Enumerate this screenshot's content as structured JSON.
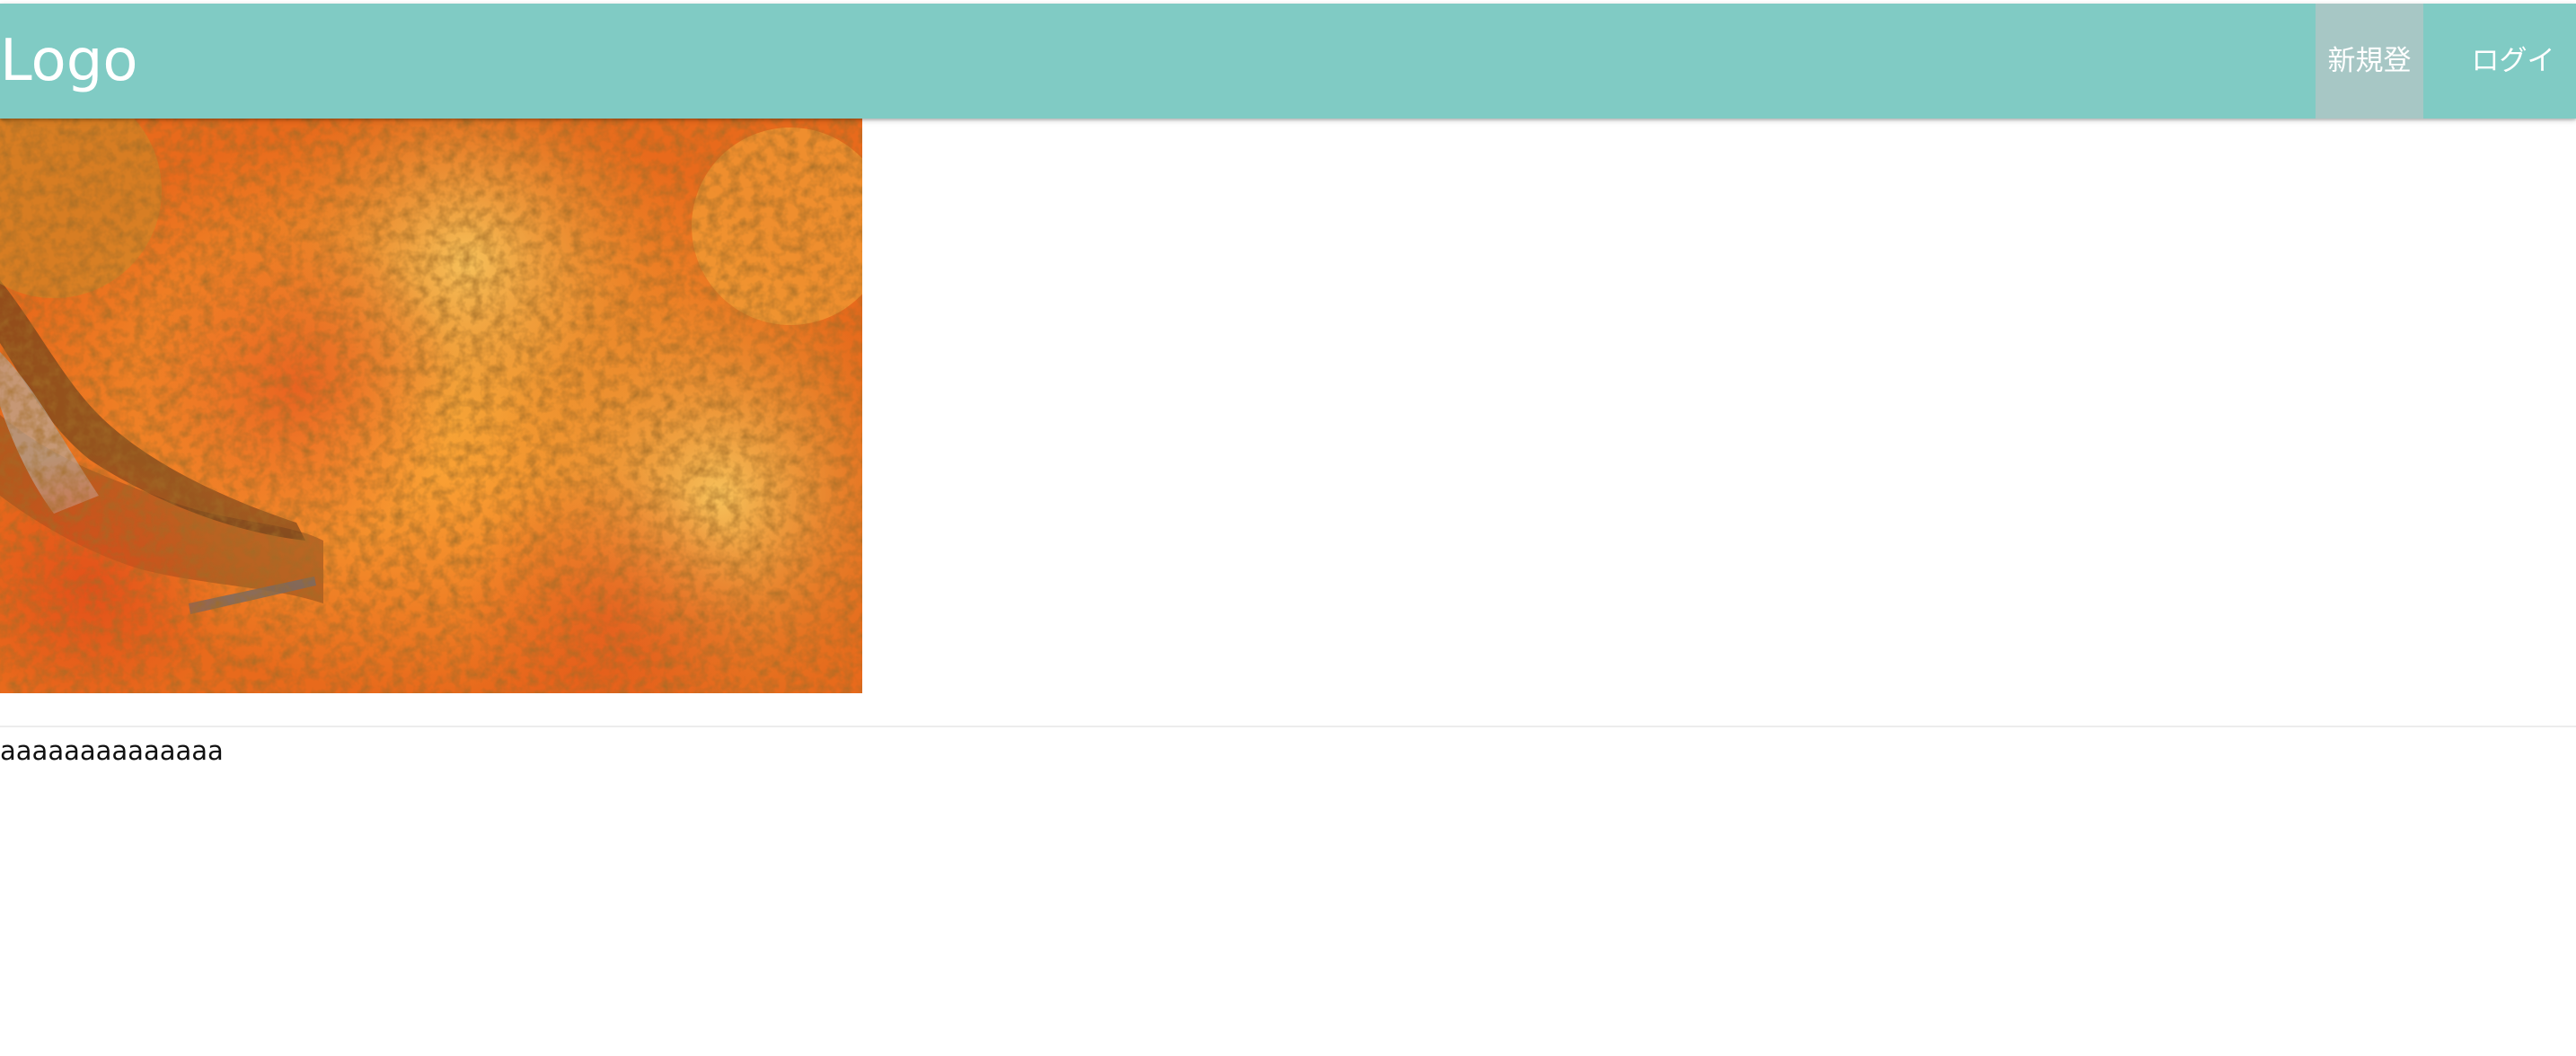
{
  "navbar": {
    "logo": "Logo",
    "links": [
      {
        "label": "新規登録"
      },
      {
        "label": "ログイン"
      }
    ],
    "color": "#80cbc4",
    "active_link_color": "#a7c7c5"
  },
  "hero": {
    "image": "autumn-foliage-photo"
  },
  "content": {
    "text": "aaaaaaaaaaaaaa"
  }
}
